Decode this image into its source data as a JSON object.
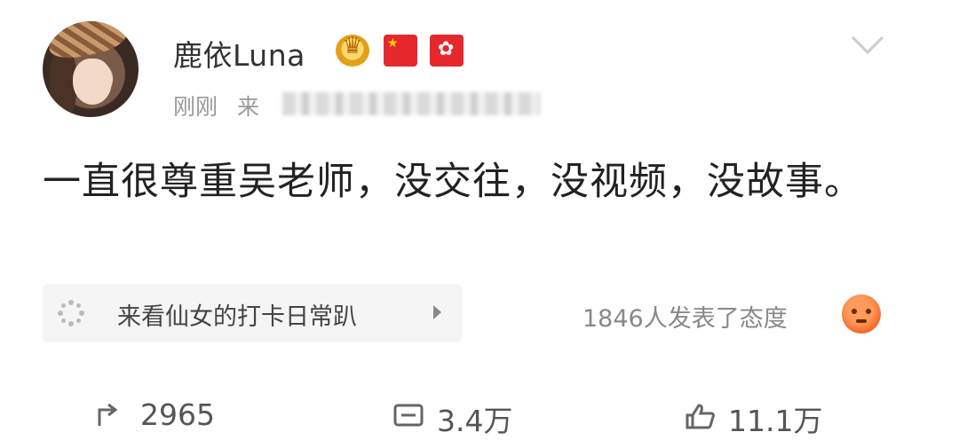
{
  "post": {
    "author": "鹿依Luna",
    "time": "刚刚",
    "source_prefix": "来",
    "text": "一直很尊重吴老师，没交往，没视频，没故事。",
    "topic": "来看仙女的打卡日常趴",
    "attitude": "1846人发表了态度"
  },
  "actions": {
    "repost_count": "2965",
    "comment_count": "3.4万",
    "like_count": "11.1万"
  },
  "icons": {
    "crown_badge": "crown-badge-icon",
    "flag_cn": "china-flag-icon",
    "flag_hk": "hong-kong-flag-icon",
    "menu": "chevron-down-icon",
    "topic": "sparkle-icon",
    "reaction": "angry-face-icon",
    "repost": "repost-icon",
    "comment": "comment-icon",
    "like": "thumbs-up-icon"
  },
  "colors": {
    "text_primary": "#333333",
    "text_meta": "#999999",
    "reaction": "#f26b2b"
  }
}
